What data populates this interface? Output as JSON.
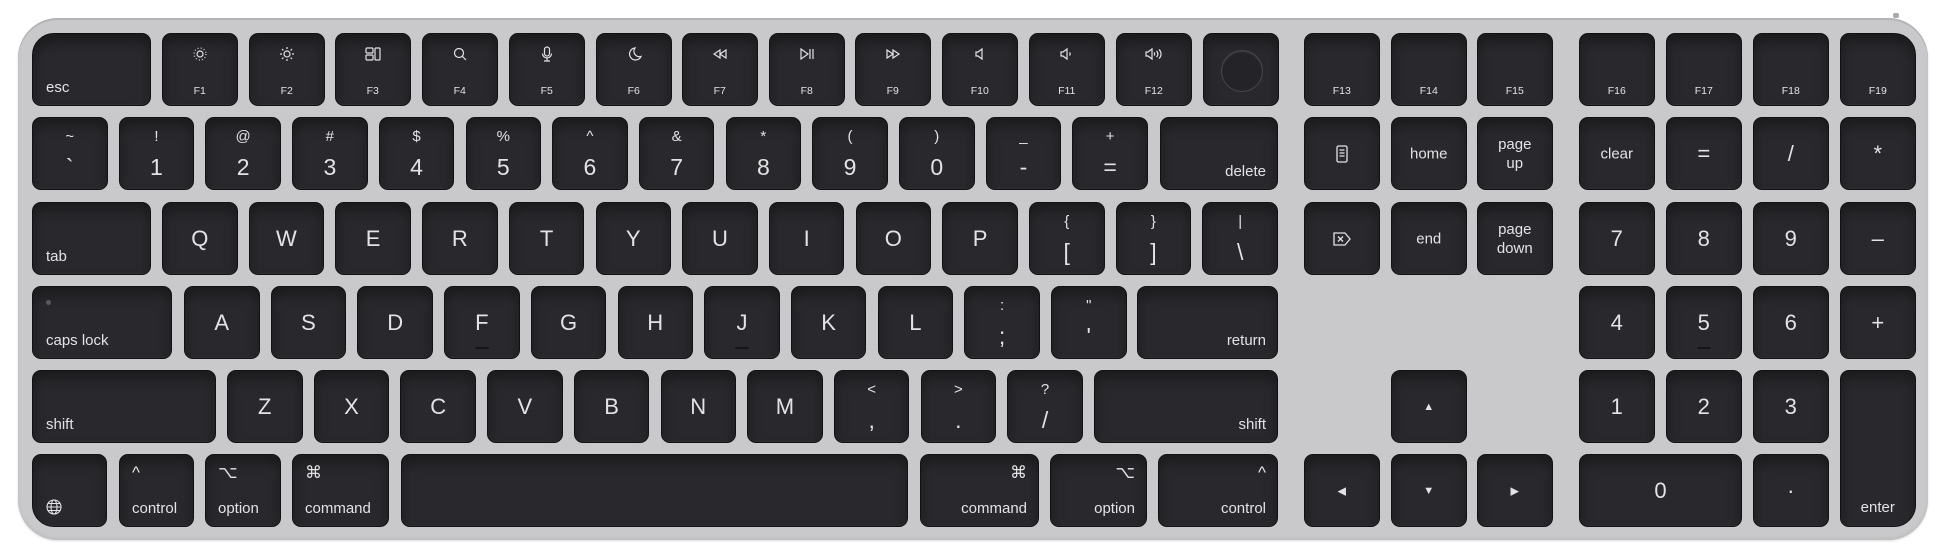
{
  "device": "Magic Keyboard with Touch ID and Numeric Keypad",
  "colors": {
    "body": "#c9c9cb",
    "key": "#29292d",
    "legend": "#e3e3e5"
  },
  "function_row": [
    {
      "id": "esc",
      "label": "esc"
    },
    {
      "id": "f1",
      "label": "F1",
      "icon": "brightness-down-icon"
    },
    {
      "id": "f2",
      "label": "F2",
      "icon": "brightness-up-icon"
    },
    {
      "id": "f3",
      "label": "F3",
      "icon": "mission-control-icon"
    },
    {
      "id": "f4",
      "label": "F4",
      "icon": "spotlight-search-icon"
    },
    {
      "id": "f5",
      "label": "F5",
      "icon": "dictation-mic-icon"
    },
    {
      "id": "f6",
      "label": "F6",
      "icon": "do-not-disturb-moon-icon"
    },
    {
      "id": "f7",
      "label": "F7",
      "icon": "rewind-icon"
    },
    {
      "id": "f8",
      "label": "F8",
      "icon": "play-pause-icon"
    },
    {
      "id": "f9",
      "label": "F9",
      "icon": "fast-forward-icon"
    },
    {
      "id": "f10",
      "label": "F10",
      "icon": "mute-icon"
    },
    {
      "id": "f11",
      "label": "F11",
      "icon": "volume-down-icon"
    },
    {
      "id": "f12",
      "label": "F12",
      "icon": "volume-up-icon"
    },
    {
      "id": "touchid",
      "label": "",
      "icon": "touch-id-icon"
    },
    {
      "id": "f13",
      "label": "F13"
    },
    {
      "id": "f14",
      "label": "F14"
    },
    {
      "id": "f15",
      "label": "F15"
    },
    {
      "id": "f16",
      "label": "F16"
    },
    {
      "id": "f17",
      "label": "F17"
    },
    {
      "id": "f18",
      "label": "F18"
    },
    {
      "id": "f19",
      "label": "F19"
    }
  ],
  "number_row": [
    {
      "id": "grave",
      "top": "~",
      "bottom": "`"
    },
    {
      "id": "1",
      "top": "!",
      "bottom": "1"
    },
    {
      "id": "2",
      "top": "@",
      "bottom": "2"
    },
    {
      "id": "3",
      "top": "#",
      "bottom": "3"
    },
    {
      "id": "4",
      "top": "$",
      "bottom": "4"
    },
    {
      "id": "5",
      "top": "%",
      "bottom": "5"
    },
    {
      "id": "6",
      "top": "^",
      "bottom": "6"
    },
    {
      "id": "7",
      "top": "&",
      "bottom": "7"
    },
    {
      "id": "8",
      "top": "*",
      "bottom": "8"
    },
    {
      "id": "9",
      "top": "(",
      "bottom": "9"
    },
    {
      "id": "0",
      "top": ")",
      "bottom": "0"
    },
    {
      "id": "minus",
      "top": "_",
      "bottom": "-"
    },
    {
      "id": "equals",
      "top": "+",
      "bottom": "="
    },
    {
      "id": "delete",
      "label": "delete"
    }
  ],
  "qwerty_row": [
    {
      "id": "tab",
      "label": "tab"
    },
    {
      "id": "q",
      "label": "Q"
    },
    {
      "id": "w",
      "label": "W"
    },
    {
      "id": "e",
      "label": "E"
    },
    {
      "id": "r",
      "label": "R"
    },
    {
      "id": "t",
      "label": "T"
    },
    {
      "id": "y",
      "label": "Y"
    },
    {
      "id": "u",
      "label": "U"
    },
    {
      "id": "i",
      "label": "I"
    },
    {
      "id": "o",
      "label": "O"
    },
    {
      "id": "p",
      "label": "P"
    },
    {
      "id": "lbracket",
      "top": "{",
      "bottom": "["
    },
    {
      "id": "rbracket",
      "top": "}",
      "bottom": "]"
    },
    {
      "id": "backslash",
      "top": "|",
      "bottom": "\\"
    }
  ],
  "home_row": [
    {
      "id": "capslock",
      "label": "caps lock"
    },
    {
      "id": "a",
      "label": "A"
    },
    {
      "id": "s",
      "label": "S"
    },
    {
      "id": "d",
      "label": "D"
    },
    {
      "id": "f",
      "label": "F",
      "homing": true
    },
    {
      "id": "g",
      "label": "G"
    },
    {
      "id": "h",
      "label": "H"
    },
    {
      "id": "j",
      "label": "J",
      "homing": true
    },
    {
      "id": "k",
      "label": "K"
    },
    {
      "id": "l",
      "label": "L"
    },
    {
      "id": "semicolon",
      "top": ":",
      "bottom": ";"
    },
    {
      "id": "quote",
      "top": "\"",
      "bottom": "'"
    },
    {
      "id": "return",
      "label": "return"
    }
  ],
  "shift_row": [
    {
      "id": "lshift",
      "label": "shift"
    },
    {
      "id": "z",
      "label": "Z"
    },
    {
      "id": "x",
      "label": "X"
    },
    {
      "id": "c",
      "label": "C"
    },
    {
      "id": "v",
      "label": "V"
    },
    {
      "id": "b",
      "label": "B"
    },
    {
      "id": "n",
      "label": "N"
    },
    {
      "id": "m",
      "label": "M"
    },
    {
      "id": "comma",
      "top": "<",
      "bottom": ","
    },
    {
      "id": "period",
      "top": ">",
      "bottom": "."
    },
    {
      "id": "slash",
      "top": "?",
      "bottom": "/"
    },
    {
      "id": "rshift",
      "label": "shift"
    }
  ],
  "bottom_row": [
    {
      "id": "globe",
      "label": "",
      "icon": "globe-icon"
    },
    {
      "id": "lcontrol",
      "symbol": "^",
      "label": "control"
    },
    {
      "id": "loption",
      "symbol": "⌥",
      "label": "option"
    },
    {
      "id": "lcommand",
      "symbol": "⌘",
      "label": "command"
    },
    {
      "id": "space",
      "label": ""
    },
    {
      "id": "rcommand",
      "symbol": "⌘",
      "label": "command"
    },
    {
      "id": "roption",
      "symbol": "⌥",
      "label": "option"
    },
    {
      "id": "rcontrol",
      "symbol": "^",
      "label": "control"
    }
  ],
  "nav_cluster": [
    {
      "id": "docs",
      "label": "",
      "icon": "document-icon"
    },
    {
      "id": "home",
      "label": "home"
    },
    {
      "id": "pageup",
      "label": "page\nup"
    },
    {
      "id": "fwddelete",
      "label": "",
      "icon": "forward-delete-icon"
    },
    {
      "id": "end",
      "label": "end"
    },
    {
      "id": "pagedown",
      "label": "page\ndown"
    },
    {
      "id": "up",
      "label": "▲"
    },
    {
      "id": "left",
      "label": "◀"
    },
    {
      "id": "down",
      "label": "▼"
    },
    {
      "id": "right",
      "label": "▶"
    }
  ],
  "numpad": [
    {
      "id": "clear",
      "label": "clear"
    },
    {
      "id": "np_equals",
      "label": "="
    },
    {
      "id": "np_divide",
      "label": "/"
    },
    {
      "id": "np_multiply",
      "label": "*"
    },
    {
      "id": "np7",
      "label": "7"
    },
    {
      "id": "np8",
      "label": "8"
    },
    {
      "id": "np9",
      "label": "9"
    },
    {
      "id": "np_minus",
      "label": "–"
    },
    {
      "id": "np4",
      "label": "4"
    },
    {
      "id": "np5",
      "label": "5",
      "homing": true
    },
    {
      "id": "np6",
      "label": "6"
    },
    {
      "id": "np_plus",
      "label": "+"
    },
    {
      "id": "np1",
      "label": "1"
    },
    {
      "id": "np2",
      "label": "2"
    },
    {
      "id": "np3",
      "label": "3"
    },
    {
      "id": "np0",
      "label": "0"
    },
    {
      "id": "np_decimal",
      "label": "·"
    },
    {
      "id": "enter",
      "label": "enter"
    }
  ]
}
